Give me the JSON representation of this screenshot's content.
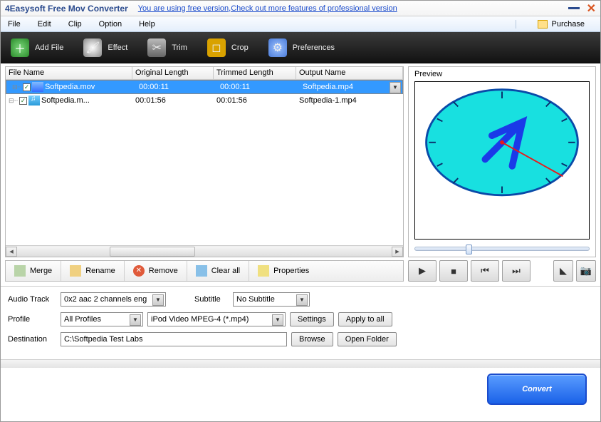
{
  "title": "4Easysoft Free Mov Converter",
  "promo_link": "You are using free version,Check out more features of professional version",
  "menu": {
    "file": "File",
    "edit": "Edit",
    "clip": "Clip",
    "option": "Option",
    "help": "Help",
    "purchase": "Purchase"
  },
  "toolbar": {
    "add_file": "Add File",
    "effect": "Effect",
    "trim": "Trim",
    "crop": "Crop",
    "preferences": "Preferences"
  },
  "columns": {
    "file_name": "File Name",
    "original_length": "Original Length",
    "trimmed_length": "Trimmed Length",
    "output_name": "Output Name"
  },
  "files": [
    {
      "checked": true,
      "type": "video",
      "name": "Softpedia.mov",
      "orig": "00:00:11",
      "trim": "00:00:11",
      "out": "Softpedia.mp4",
      "selected": true
    },
    {
      "checked": true,
      "type": "audio",
      "name": "Softpedia.m...",
      "orig": "00:01:56",
      "trim": "00:01:56",
      "out": "Softpedia-1.mp4",
      "selected": false
    }
  ],
  "preview_label": "Preview",
  "actions": {
    "merge": "Merge",
    "rename": "Rename",
    "remove": "Remove",
    "clear_all": "Clear all",
    "properties": "Properties"
  },
  "labels": {
    "audio_track": "Audio Track",
    "subtitle": "Subtitle",
    "profile": "Profile",
    "destination": "Destination"
  },
  "audio_track_value": "0x2 aac 2 channels eng",
  "subtitle_value": "No Subtitle",
  "profile_group": "All Profiles",
  "profile_value": "iPod Video MPEG-4 (*.mp4)",
  "destination_value": "C:\\Softpedia Test Labs",
  "buttons": {
    "settings": "Settings",
    "apply_all": "Apply to all",
    "browse": "Browse",
    "open_folder": "Open Folder",
    "convert": "Convert"
  }
}
